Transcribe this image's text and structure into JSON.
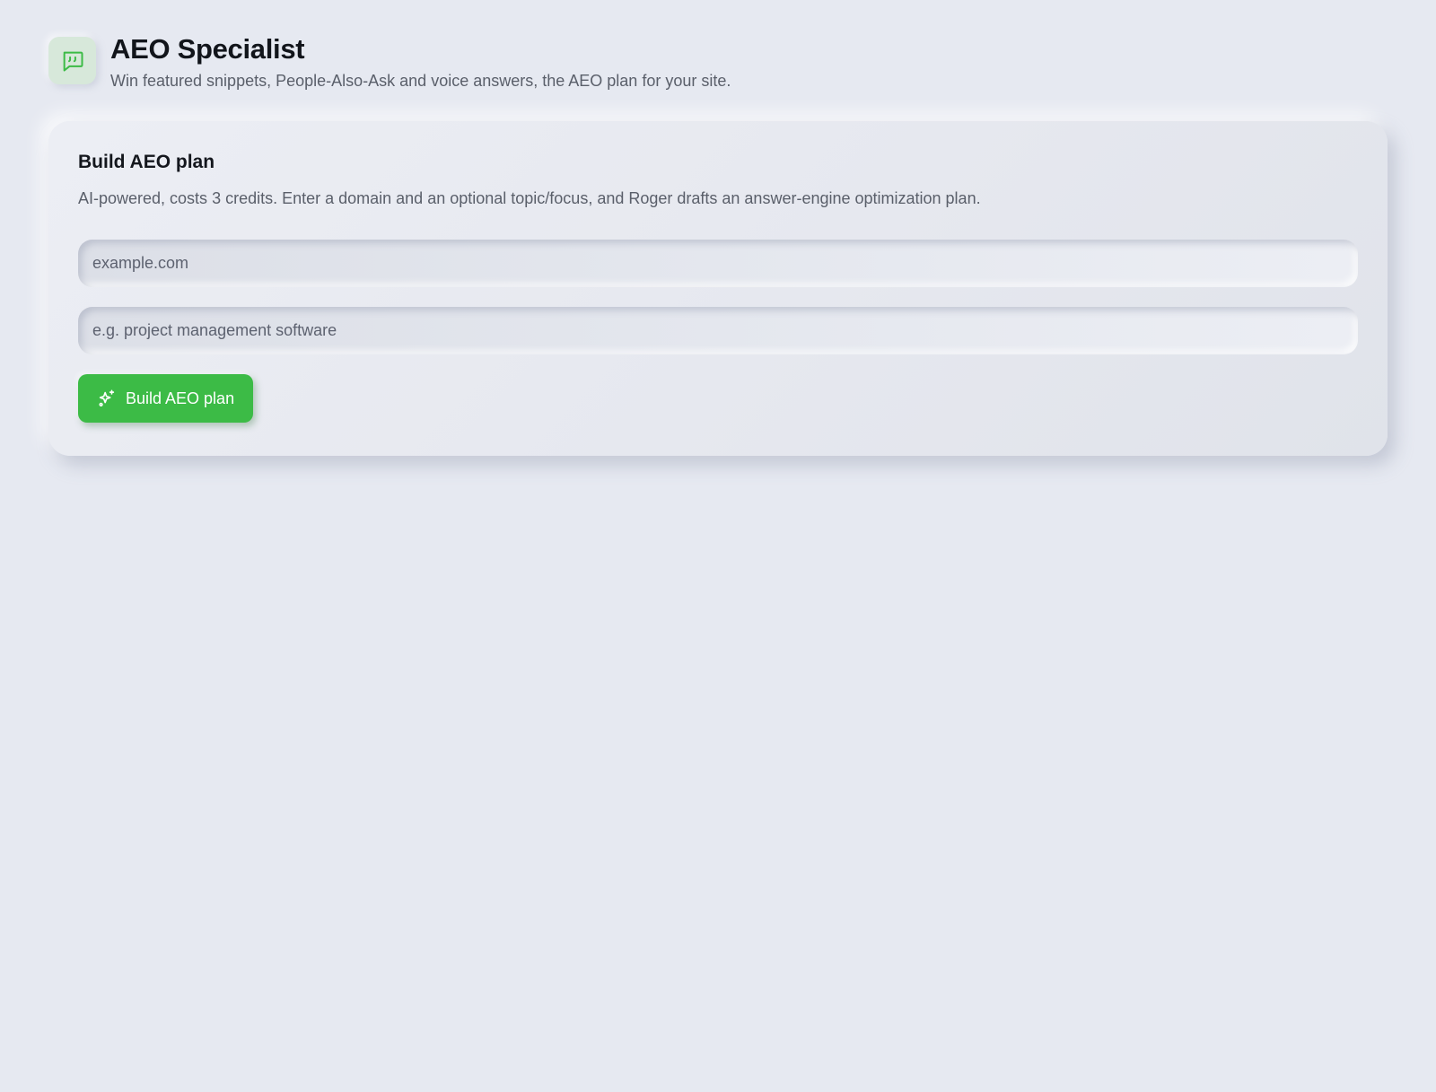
{
  "header": {
    "title": "AEO Specialist",
    "subtitle": "Win featured snippets, People-Also-Ask and voice answers, the AEO plan for your site.",
    "icon": "message-quote-icon",
    "icon_color": "#3cbb46"
  },
  "card": {
    "title": "Build AEO plan",
    "description": "AI-powered, costs 3 credits. Enter a domain and an optional topic/focus, and Roger drafts an answer-engine optimization plan.",
    "domain_input": {
      "value": "",
      "placeholder": "example.com"
    },
    "topic_input": {
      "value": "",
      "placeholder": "e.g. project management software"
    },
    "submit_button": {
      "label": "Build AEO plan",
      "icon": "sparkles-icon",
      "color": "#3cbb46"
    }
  }
}
